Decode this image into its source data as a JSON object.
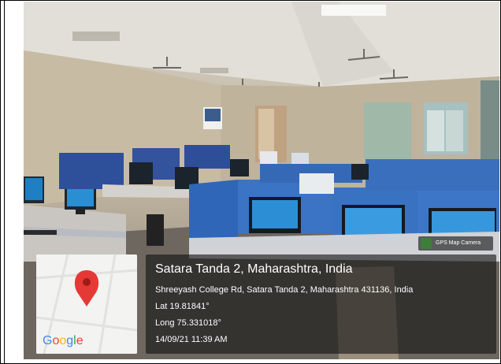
{
  "overlay": {
    "location_title": "Satara Tanda 2, Maharashtra, India",
    "address": "Shreeyash College Rd, Satara Tanda 2, Maharashtra 431136, India",
    "latitude": "Lat 19.81841°",
    "longitude": "Long 75.331018°",
    "timestamp": "14/09/21 11:39 AM"
  },
  "map": {
    "logo_letters": [
      "G",
      "o",
      "o",
      "g",
      "l",
      "e"
    ],
    "pin_color": "#E53935",
    "pin_icon": "map-pin-icon"
  },
  "badge": {
    "label": "GPS Map Camera",
    "icon": "camera-globe-icon"
  }
}
